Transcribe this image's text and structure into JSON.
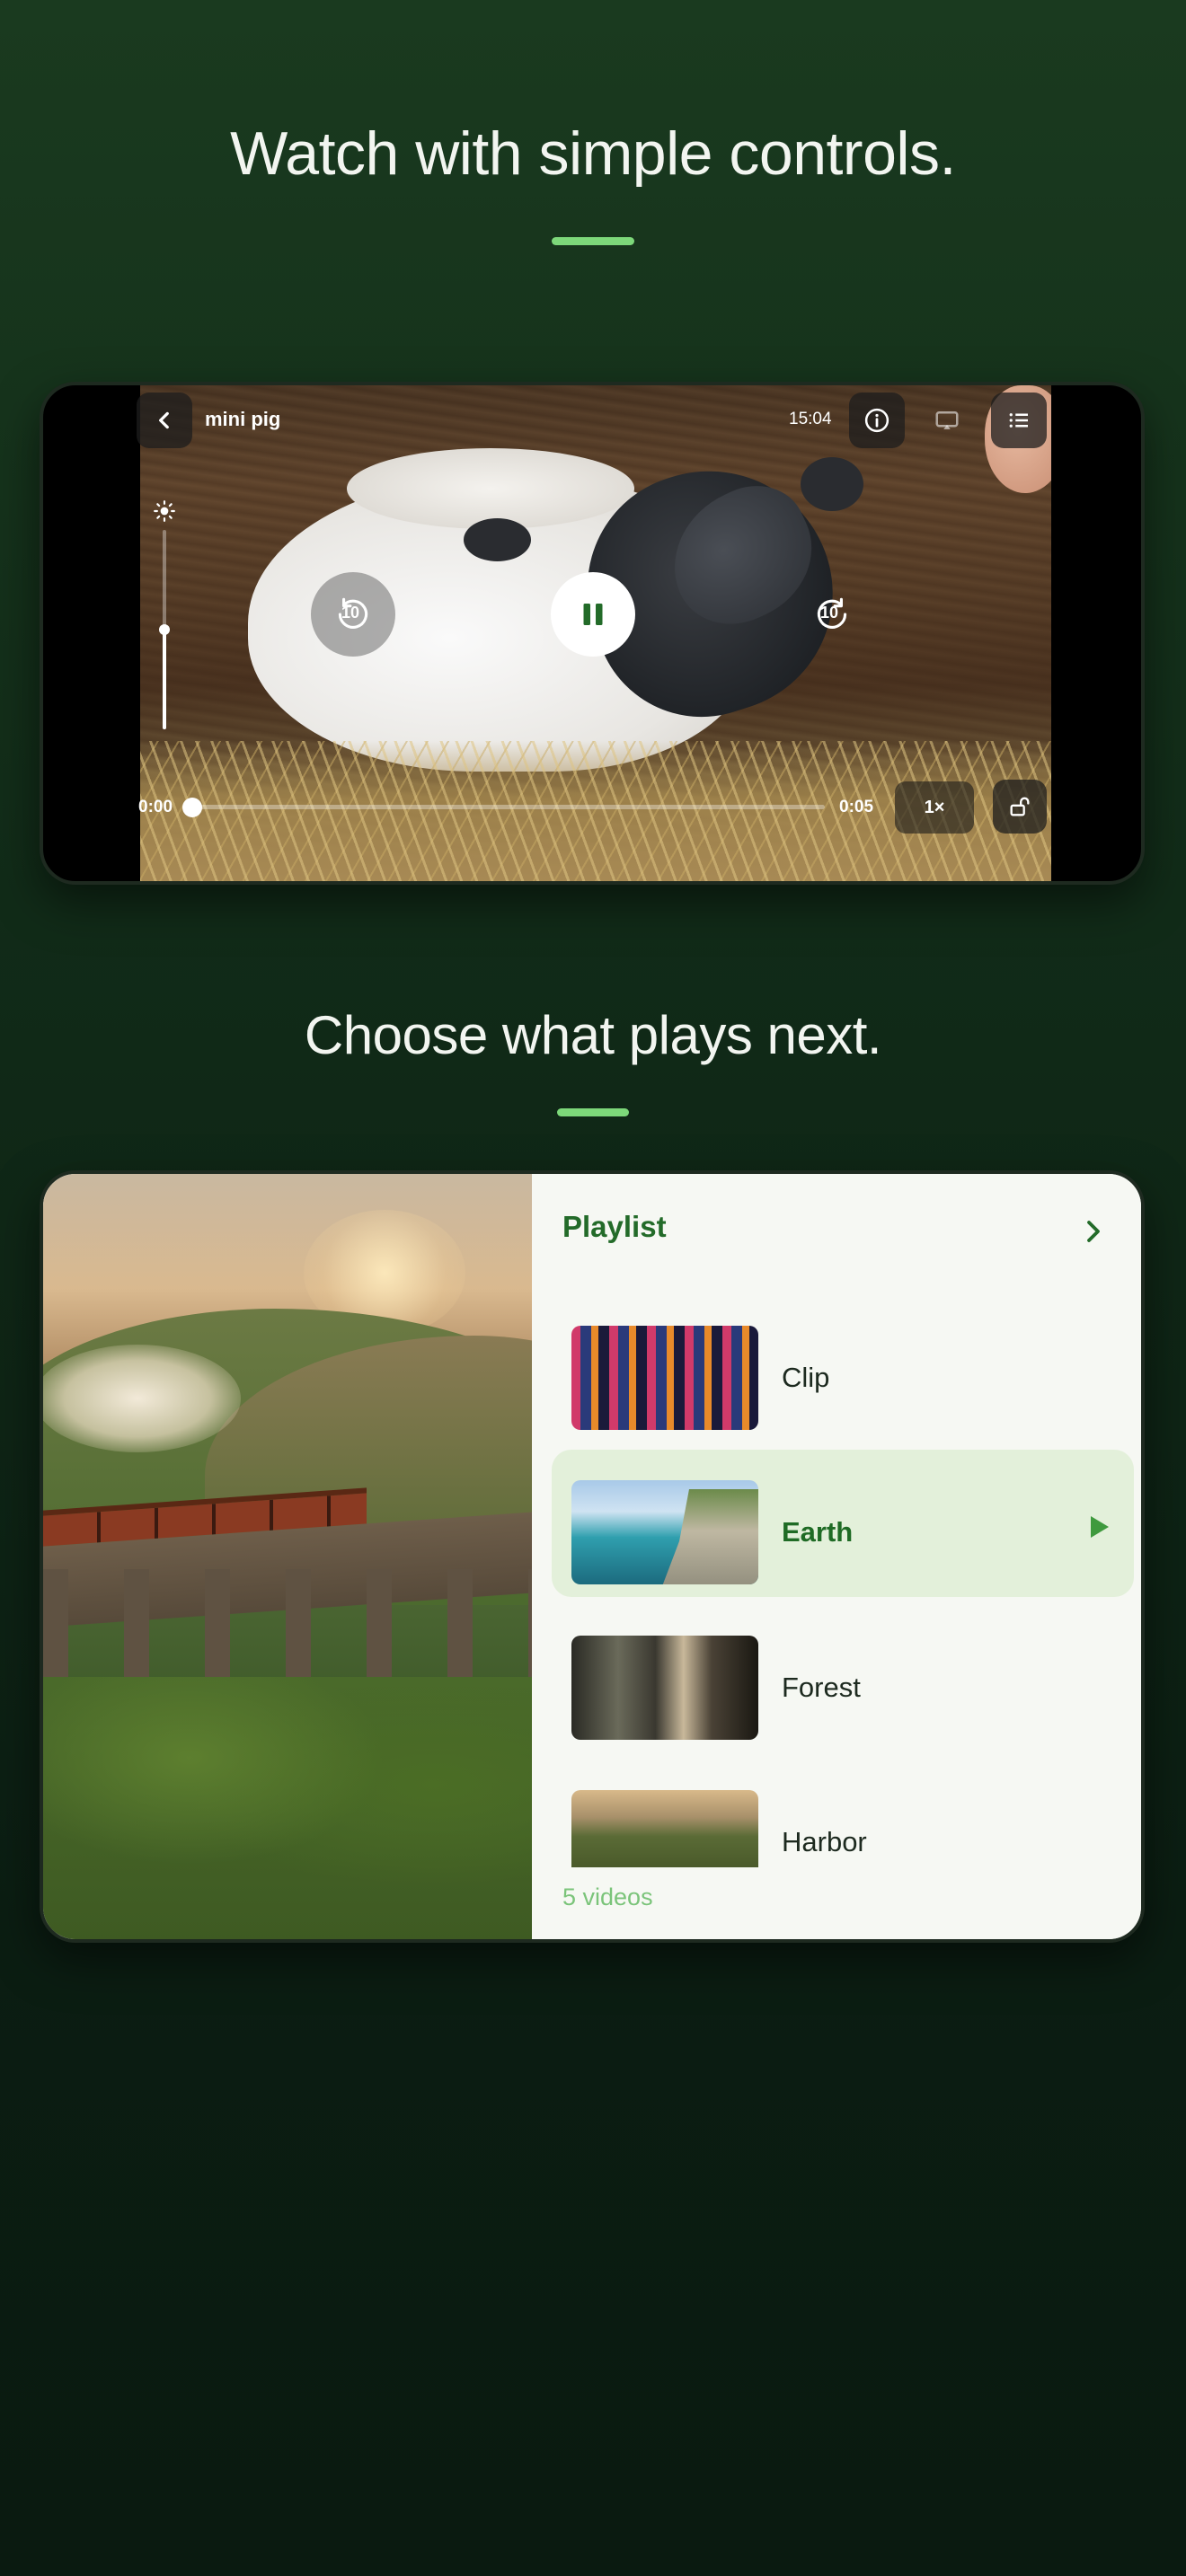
{
  "section1": {
    "headline": "Watch with simple controls."
  },
  "player": {
    "video_title": "mini pig",
    "clock": "15:04",
    "rewind_seconds": "10",
    "forward_seconds": "10",
    "current_time": "0:00",
    "duration": "0:05",
    "speed": "1×",
    "brightness_level": 0.5,
    "progress_fraction": 0.0,
    "state": "playing"
  },
  "section2": {
    "headline": "Choose what plays next."
  },
  "playlist": {
    "title": "Playlist",
    "items": [
      {
        "label": "Clip",
        "active": false
      },
      {
        "label": "Earth",
        "active": true
      },
      {
        "label": "Forest",
        "active": false
      },
      {
        "label": "Harbor",
        "active": false
      }
    ],
    "count_text": "5 videos"
  },
  "colors": {
    "accent": "#7dd87a",
    "brand_green": "#236b29",
    "active_row_bg": "#e3f0da",
    "background_top": "#1a3a1f",
    "background_bottom": "#0a1a10"
  }
}
